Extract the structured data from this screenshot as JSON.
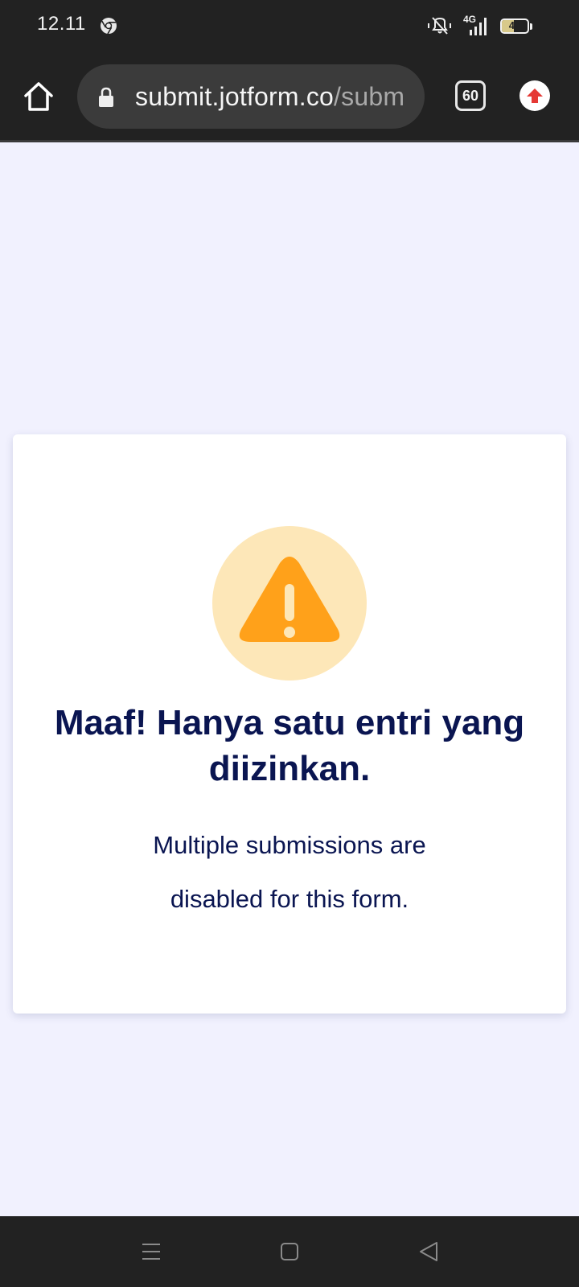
{
  "status_bar": {
    "time": "12.11",
    "network": "4G",
    "battery_level": "47",
    "battery_fraction": 0.47
  },
  "toolbar": {
    "url_domain": "submit.jotform.co",
    "url_path": "/subm",
    "tab_count": "60"
  },
  "page": {
    "title": "Maaf! Hanya satu entri yang diizinkan.",
    "message": "Multiple submissions are disabled for this form."
  },
  "colors": {
    "warning_orange": "#ffa11a",
    "warning_circle": "#fde7b8",
    "text_navy": "#0a1551",
    "page_bg": "#f1f1fe",
    "update_red": "#e53935"
  },
  "icons": {
    "home": "home-icon",
    "lock": "lock-icon",
    "tabs": "tab-switcher-icon",
    "update": "update-arrow-icon",
    "warning": "warning-triangle-icon",
    "mute": "mute-icon",
    "signal": "signal-icon",
    "battery": "battery-icon",
    "chrome": "chrome-icon",
    "nav_menu": "menu-icon",
    "nav_home": "square-home-icon",
    "nav_back": "back-icon"
  }
}
